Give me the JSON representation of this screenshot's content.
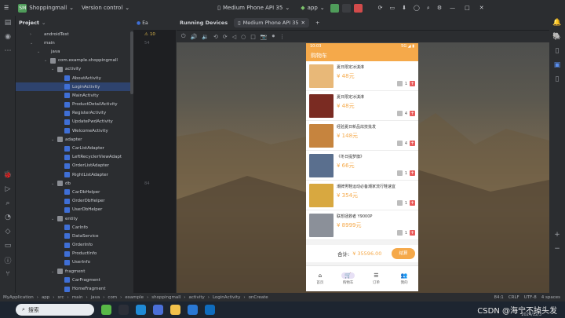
{
  "titlebar": {
    "project": "Shoppingmall",
    "project_badge": "SM",
    "vcs": "Version control",
    "device": "Medium Phone API 35",
    "run_config": "app"
  },
  "project_panel": {
    "title": "Project",
    "tree": [
      {
        "label": "androidTest",
        "type": "folder",
        "depth": 2,
        "arrow": "›"
      },
      {
        "label": "main",
        "type": "folder",
        "depth": 2,
        "arrow": "⌄"
      },
      {
        "label": "java",
        "type": "folder",
        "depth": 3,
        "arrow": "⌄"
      },
      {
        "label": "com.example.shoppingmall",
        "type": "pkg",
        "depth": 4,
        "arrow": "⌄"
      },
      {
        "label": "activity",
        "type": "pkg",
        "depth": 5,
        "arrow": "⌄"
      },
      {
        "label": "AboutActivity",
        "type": "cls",
        "depth": 6,
        "arrow": ""
      },
      {
        "label": "LoginActivity",
        "type": "cls",
        "depth": 6,
        "arrow": "",
        "selected": true
      },
      {
        "label": "MainActivity",
        "type": "cls",
        "depth": 6,
        "arrow": ""
      },
      {
        "label": "ProductDetailActivity",
        "type": "cls",
        "depth": 6,
        "arrow": ""
      },
      {
        "label": "RegisterActivity",
        "type": "cls",
        "depth": 6,
        "arrow": ""
      },
      {
        "label": "UpdatePwdActivity",
        "type": "cls",
        "depth": 6,
        "arrow": ""
      },
      {
        "label": "WelcomeActivity",
        "type": "cls",
        "depth": 6,
        "arrow": ""
      },
      {
        "label": "adapter",
        "type": "pkg",
        "depth": 5,
        "arrow": "⌄"
      },
      {
        "label": "CarListAdapter",
        "type": "cls",
        "depth": 6,
        "arrow": ""
      },
      {
        "label": "LeftRecyclerViewAdapt",
        "type": "cls",
        "depth": 6,
        "arrow": ""
      },
      {
        "label": "OrderListAdapter",
        "type": "cls",
        "depth": 6,
        "arrow": ""
      },
      {
        "label": "RightListAdapter",
        "type": "cls",
        "depth": 6,
        "arrow": ""
      },
      {
        "label": "db",
        "type": "pkg",
        "depth": 5,
        "arrow": "⌄"
      },
      {
        "label": "CarDbHelper",
        "type": "cls",
        "depth": 6,
        "arrow": ""
      },
      {
        "label": "OrderDbHelper",
        "type": "cls",
        "depth": 6,
        "arrow": ""
      },
      {
        "label": "UserDbHelper",
        "type": "cls",
        "depth": 6,
        "arrow": ""
      },
      {
        "label": "entity",
        "type": "pkg",
        "depth": 5,
        "arrow": "⌄"
      },
      {
        "label": "CarInfo",
        "type": "cls",
        "depth": 6,
        "arrow": ""
      },
      {
        "label": "DataService",
        "type": "cls",
        "depth": 6,
        "arrow": ""
      },
      {
        "label": "OrderInfo",
        "type": "cls",
        "depth": 6,
        "arrow": ""
      },
      {
        "label": "ProductInfo",
        "type": "cls",
        "depth": 6,
        "arrow": ""
      },
      {
        "label": "UserInfo",
        "type": "cls",
        "depth": 6,
        "arrow": ""
      },
      {
        "label": "fragment",
        "type": "pkg",
        "depth": 5,
        "arrow": "⌄"
      },
      {
        "label": "CarFragment",
        "type": "cls",
        "depth": 6,
        "arrow": ""
      },
      {
        "label": "HomeFragment",
        "type": "cls",
        "depth": 6,
        "arrow": ""
      }
    ]
  },
  "editor": {
    "tab": "Ea",
    "warning_count": "10",
    "line_numbers": [
      "54",
      "",
      "",
      "",
      "",
      "",
      "",
      "",
      "",
      "",
      "",
      "",
      "",
      "",
      "",
      "",
      "84",
      "",
      "",
      "",
      "",
      "",
      "",
      "",
      "",
      "",
      "",
      "",
      ""
    ]
  },
  "running": {
    "title": "Running Devices",
    "device_tab": "Medium Phone API 35"
  },
  "phone": {
    "time": "10:03",
    "signal": "5G ◢ ▮",
    "appbar_title": "购物车",
    "products": [
      {
        "name": "夏日限定冰淇淋",
        "price": "¥ 48元",
        "qty": "1",
        "color": "#e8b878"
      },
      {
        "name": "夏日限定冰淇淋",
        "price": "¥ 48元",
        "qty": "4",
        "color": "#7a2b22"
      },
      {
        "name": "经验夏日新品炫技批发",
        "price": "¥ 148元",
        "qty": "4",
        "color": "#c6843e"
      },
      {
        "name": "《冬日提梦旗》",
        "price": "¥ 66元",
        "qty": "1",
        "color": "#5a6f8e"
      },
      {
        "name": "潮牌男鞋运动必备潮家流行鞋速宜",
        "price": "¥ 354元",
        "qty": "1",
        "color": "#d8a840"
      },
      {
        "name": "联想拯救者 Y9000P",
        "price": "¥ 8999元",
        "qty": "1",
        "color": "#8b9099"
      }
    ],
    "checkout": {
      "label": "合计:",
      "total": "¥ 35596.00",
      "button": "结算"
    },
    "nav": [
      {
        "label": "首页",
        "icon": "⌂"
      },
      {
        "label": "购物车",
        "icon": "🛒",
        "active": true
      },
      {
        "label": "订单",
        "icon": "☰"
      },
      {
        "label": "我的",
        "icon": "👥"
      }
    ]
  },
  "statusbar": {
    "crumbs": [
      "MyApplication",
      "app",
      "src",
      "main",
      "java",
      "com",
      "example",
      "shoppingmall",
      "activity",
      "LoginActivity",
      "onCreate"
    ],
    "position": "84:1",
    "line_sep": "CRLF",
    "encoding": "UTF-8",
    "indent": "4 spaces"
  },
  "taskbar": {
    "search_placeholder": "搜索",
    "watermark": "CSDN @海宁不掉头发",
    "date": "2024/12/3"
  }
}
